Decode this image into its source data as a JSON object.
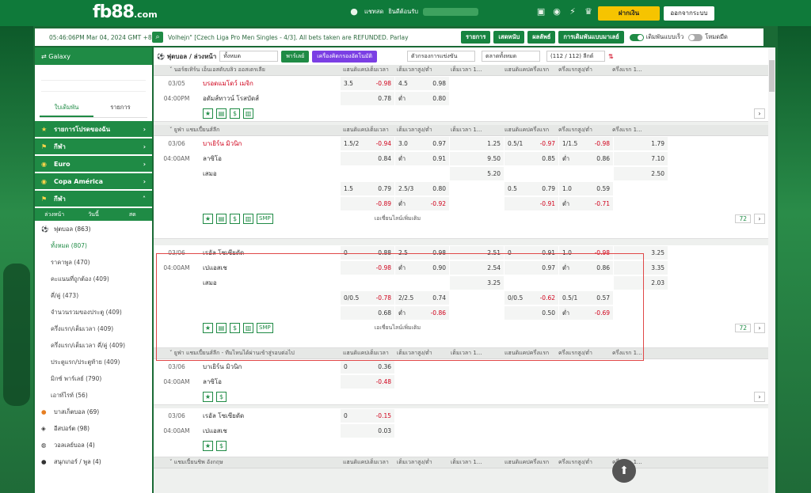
{
  "header": {
    "logo": "fb88",
    "logo_suffix": ".com",
    "chat": "แชทสด",
    "welcome": "ยินดีต้อนรับ",
    "deposit": "ฝากเงิน",
    "logout": "ออกจากระบบ"
  },
  "ticker": {
    "time": "05:46:06PM Mar 04, 2024 GMT +8",
    "message": "Volhejn\" [Czech Liga Pro Men Singles - 4/3]. All bets taken are REFUNDED. Parlay",
    "btn1": "รายการ",
    "btn2": "เสดหนับ",
    "btn3": "ผลลัพธ์",
    "btn4": "การเดิมพันแบบมาเลย์",
    "toggle1": "เดิมพันแบบเร็ว",
    "toggle2": "โหมดมืด"
  },
  "sidebar": {
    "galaxy": "Galaxy",
    "tab_bet": "ใบเดิมพัน",
    "tab_list": "รายการ",
    "favorites": "รายการโปรดของฉัน",
    "sports": "กีฬา",
    "euro": "Euro",
    "copa": "Copa América",
    "sports2": "กีฬา",
    "sub_tabs": [
      "ล่วงหน้า",
      "วันนี้",
      "สด"
    ],
    "items": [
      {
        "label": "ฟุตบอล",
        "count": "(863)"
      },
      {
        "label": "ทั้งหมด",
        "count": "(807)"
      },
      {
        "label": "ราคาพูล",
        "count": "(470)"
      },
      {
        "label": "คะแนนที่ถูกต้อง",
        "count": "(409)"
      },
      {
        "label": "คี่/คู่",
        "count": "(473)"
      },
      {
        "label": "จำนวนรวมของประตู",
        "count": "(409)"
      },
      {
        "label": "ครึ่งแรก/เต็มเวลา",
        "count": "(409)"
      },
      {
        "label": "ครึ่งแรก/เต็มเวลา คี่/คู่",
        "count": "(409)"
      },
      {
        "label": "ประตูแรก/ประตูท้าย",
        "count": "(409)"
      },
      {
        "label": "มิกซ์ พาร์เลย์",
        "count": "(790)"
      },
      {
        "label": "เอาท์ไรท์",
        "count": "(56)"
      },
      {
        "label": "บาสเก็ตบอล",
        "count": "(69)"
      },
      {
        "label": "อีสปอร์ต",
        "count": "(98)"
      },
      {
        "label": "วอลเลย์บอล",
        "count": "(4)"
      },
      {
        "label": "สนุกเกอร์ / พูล",
        "count": "(4)"
      }
    ]
  },
  "main": {
    "title": "ฟุตบอล / ล่วงหน้า",
    "filter1": "ทั้งหมด",
    "parlay": "พาร์เลย์",
    "calc": "เครื่องคิดกรองอัตโนมัติ",
    "filter2": "ตัวกรองการแข่งขัน",
    "filter3": "ตลาดทั้งหมด",
    "leagues": "(112 / 112) ลีกต์",
    "cols": [
      "แฮนดิแคปเต็มเวลา",
      "เต็มเวลาสูง/ต่ำ",
      "เต็มเวลา 1...",
      "แฮนดิแคปครึ่งแรก",
      "ครึ่งแรกสูง/ต่ำ",
      "ครึ่งแรก 1..."
    ],
    "leagues_list": [
      {
        "name": "นอร์ธเทิร์น เอ็นเอสดับบลิว ออสเตรเลีย"
      },
      {
        "name": "ยูฟ่า แชมเปี้ยนส์ลีก"
      },
      {
        "name": "ยูฟ่า แชมเปี้ยนส์ลีก - ทีมไหนได้ผ่านเข้าสู่รอบต่อไป"
      },
      {
        "name": "แชมเปี้ยนชิพ อังกฤษ"
      }
    ],
    "m1": {
      "date": "03/05",
      "time": "04:00PM",
      "home": "บรอดแมโดว์ เมจิก",
      "away": "อดัมส์ทาวน์ โรสบัดส์",
      "r1": [
        "3.5",
        "-0.98",
        "4.5",
        "0.98"
      ],
      "r2": [
        "",
        "0.78",
        "ต่ำ",
        "0.80"
      ]
    },
    "m2": {
      "date": "03/06",
      "time": "04:00AM",
      "home": "บาเยิร์น มิวนิก",
      "away": "ลาซิโอ",
      "draw": "เสมอ",
      "rows": [
        [
          "1.5/2",
          "-0.94",
          "3.0",
          "0.97",
          "1.25",
          "0.5/1",
          "-0.97",
          "1/1.5",
          "-0.98",
          "1.79"
        ],
        [
          "",
          "0.84",
          "ต่ำ",
          "0.91",
          "9.50",
          "",
          "0.85",
          "ต่ำ",
          "0.86",
          "7.10"
        ],
        [
          "",
          "",
          "",
          "",
          "5.20",
          "",
          "",
          "",
          "",
          "2.50"
        ],
        [
          "1.5",
          "0.79",
          "2.5/3",
          "0.80",
          "",
          "0.5",
          "0.79",
          "1.0",
          "0.59",
          ""
        ],
        [
          "",
          "-0.89",
          "ต่ำ",
          "-0.92",
          "",
          "",
          "-0.91",
          "ต่ำ",
          "-0.71",
          ""
        ]
      ],
      "more": "เอเชี่ยนไลน์เพิ่มเติม",
      "count": "72"
    },
    "m3": {
      "date": "03/06",
      "time": "04:00AM",
      "home": "เรอัล โซเซียดัด",
      "away": "เปแอสเช",
      "draw": "เสมอ",
      "rows": [
        [
          "0",
          "0.88",
          "2.5",
          "0.98",
          "2.51",
          "0",
          "0.91",
          "1.0",
          "-0.98",
          "3.25"
        ],
        [
          "",
          "-0.98",
          "ต่ำ",
          "0.90",
          "2.54",
          "",
          "0.97",
          "ต่ำ",
          "0.86",
          "3.35"
        ],
        [
          "",
          "",
          "",
          "",
          "3.25",
          "",
          "",
          "",
          "",
          "2.03"
        ],
        [
          "0/0.5",
          "-0.78",
          "2/2.5",
          "0.74",
          "",
          "0/0.5",
          "-0.62",
          "0.5/1",
          "0.57",
          ""
        ],
        [
          "",
          "0.68",
          "ต่ำ",
          "-0.86",
          "",
          "",
          "0.50",
          "ต่ำ",
          "-0.69",
          ""
        ]
      ],
      "more": "เอเชี่ยนไลน์เพิ่มเติม",
      "count": "72"
    },
    "m4": {
      "date": "03/06",
      "time": "04:00AM",
      "home": "บาเยิร์น มิวนิก",
      "away": "ลาซิโอ",
      "r1": [
        "0",
        "0.36"
      ],
      "r2": [
        "",
        "-0.48"
      ]
    },
    "m5": {
      "date": "03/06",
      "time": "04:00AM",
      "home": "เรอัล โซเซียดัด",
      "away": "เปแอสเช",
      "r1": [
        "0",
        "-0.15"
      ],
      "r2": [
        "",
        "0.03"
      ]
    },
    "smp": "SMP"
  }
}
